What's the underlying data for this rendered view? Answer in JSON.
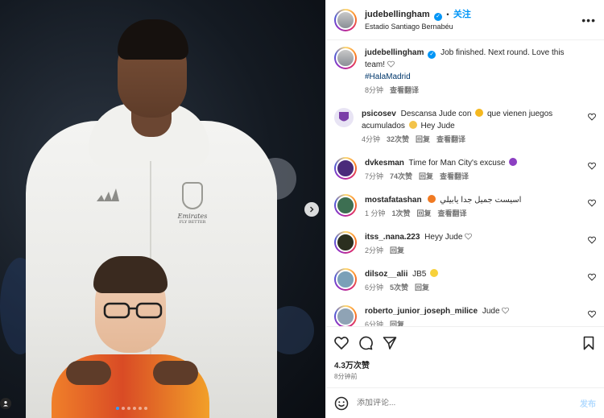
{
  "post": {
    "username": "judebellingham",
    "verified": true,
    "follow_label": "关注",
    "location": "Estadio Santiago Bernabéu",
    "more_icon": "more-horizontal-icon"
  },
  "caption": {
    "username": "judebellingham",
    "text": "Job finished. Next round. Love this team!",
    "hashtag": "#HalaMadrid",
    "time": "8分钟",
    "translate_label": "查看翻译"
  },
  "comments": [
    {
      "username": "psicosev",
      "text_before": "Descansa Jude con",
      "text_after": "que vienen juegos acumulados",
      "text_end": "Hey Jude",
      "time": "4分钟",
      "likes": "32次赞",
      "reply_label": "回复",
      "translate_label": "查看翻译",
      "avatar_color": "#e8e4f4"
    },
    {
      "username": "dvkesman",
      "text_before": "Time for Man City's excuse",
      "time": "7分钟",
      "likes": "74次赞",
      "reply_label": "回复",
      "translate_label": "查看翻译",
      "avatar_color": "#4a2a7a"
    },
    {
      "username": "mostafatashan",
      "text_before": "اسيست جميل جدا يابيلي",
      "time": "1 分钟",
      "likes": "1次赞",
      "reply_label": "回复",
      "translate_label": "查看翻译",
      "avatar_color": "#3d6f52"
    },
    {
      "username": "itss_.nana.223",
      "text_before": "Heyy Jude",
      "time": "2分钟",
      "reply_label": "回复",
      "avatar_color": "#2b2f1f"
    },
    {
      "username": "dilsoz__alii",
      "text_before": "JB5",
      "time": "6分钟",
      "likes": "5次赞",
      "reply_label": "回复",
      "avatar_color": "#7aa0b8"
    },
    {
      "username": "roberto_junior_joseph_milice",
      "text_before": "Jude",
      "time": "6分钟",
      "reply_label": "回复",
      "avatar_color": "#8fa3b5"
    }
  ],
  "footer": {
    "likes_count": "4.3万次赞",
    "time_ago": "8分钟前",
    "comment_placeholder": "添加评论...",
    "post_label": "发布"
  },
  "colors": {
    "accent": "#0095f6",
    "post_disabled": "#b3dbff"
  },
  "photo": {
    "jersey_sponsor": "Emirates",
    "jersey_sponsor_sub": "FLY BETTER",
    "carousel_index": 1,
    "carousel_count": 6
  }
}
